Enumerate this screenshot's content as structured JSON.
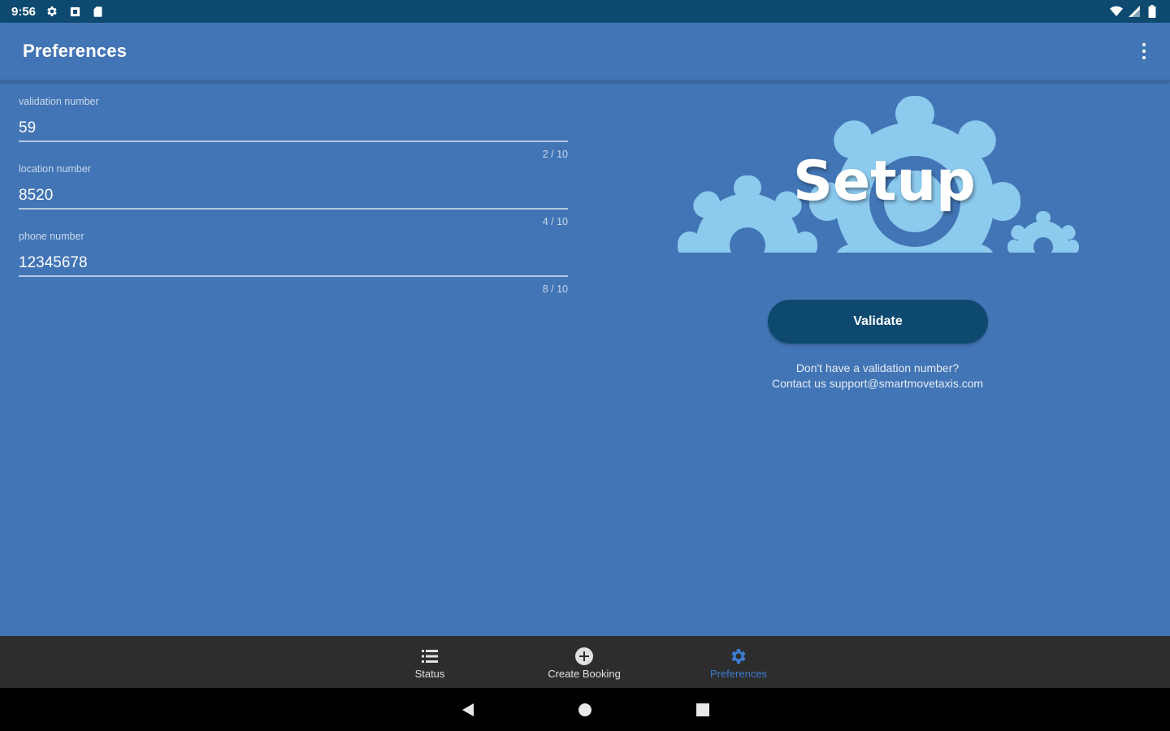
{
  "status_bar": {
    "time": "9:56",
    "left_icons": [
      "gear-icon",
      "cast-icon",
      "sd-card-icon"
    ],
    "right_icons": [
      "wifi-icon",
      "signal-icon",
      "battery-icon"
    ]
  },
  "app_bar": {
    "title": "Preferences",
    "overflow_icon": "more-vert-icon"
  },
  "form": {
    "fields": [
      {
        "label": "validation number",
        "value": "59",
        "counter": "2 / 10"
      },
      {
        "label": "location number",
        "value": "8520",
        "counter": "4 / 10"
      },
      {
        "label": "phone number",
        "value": "12345678",
        "counter": "8 / 10"
      }
    ]
  },
  "setup": {
    "title": "Setup",
    "gear_color": "#8ccaee",
    "button_label": "Validate",
    "help_line1": "Don't have a validation number?",
    "help_line2": "Contact us support@smartmovetaxis.com"
  },
  "bottom_nav": {
    "items": [
      {
        "label": "Status",
        "icon": "list-icon",
        "active": false
      },
      {
        "label": "Create Booking",
        "icon": "add-circle-icon",
        "active": false
      },
      {
        "label": "Preferences",
        "icon": "gear-icon",
        "active": true
      }
    ],
    "active_color": "#3e7bd0"
  },
  "system_nav": {
    "buttons": [
      "back-icon",
      "home-icon",
      "recents-icon"
    ]
  },
  "colors": {
    "background": "#4275b5",
    "status_bar": "#0e4a6f",
    "button": "#0e4a6f",
    "bottom_nav": "#2d2d2d"
  }
}
